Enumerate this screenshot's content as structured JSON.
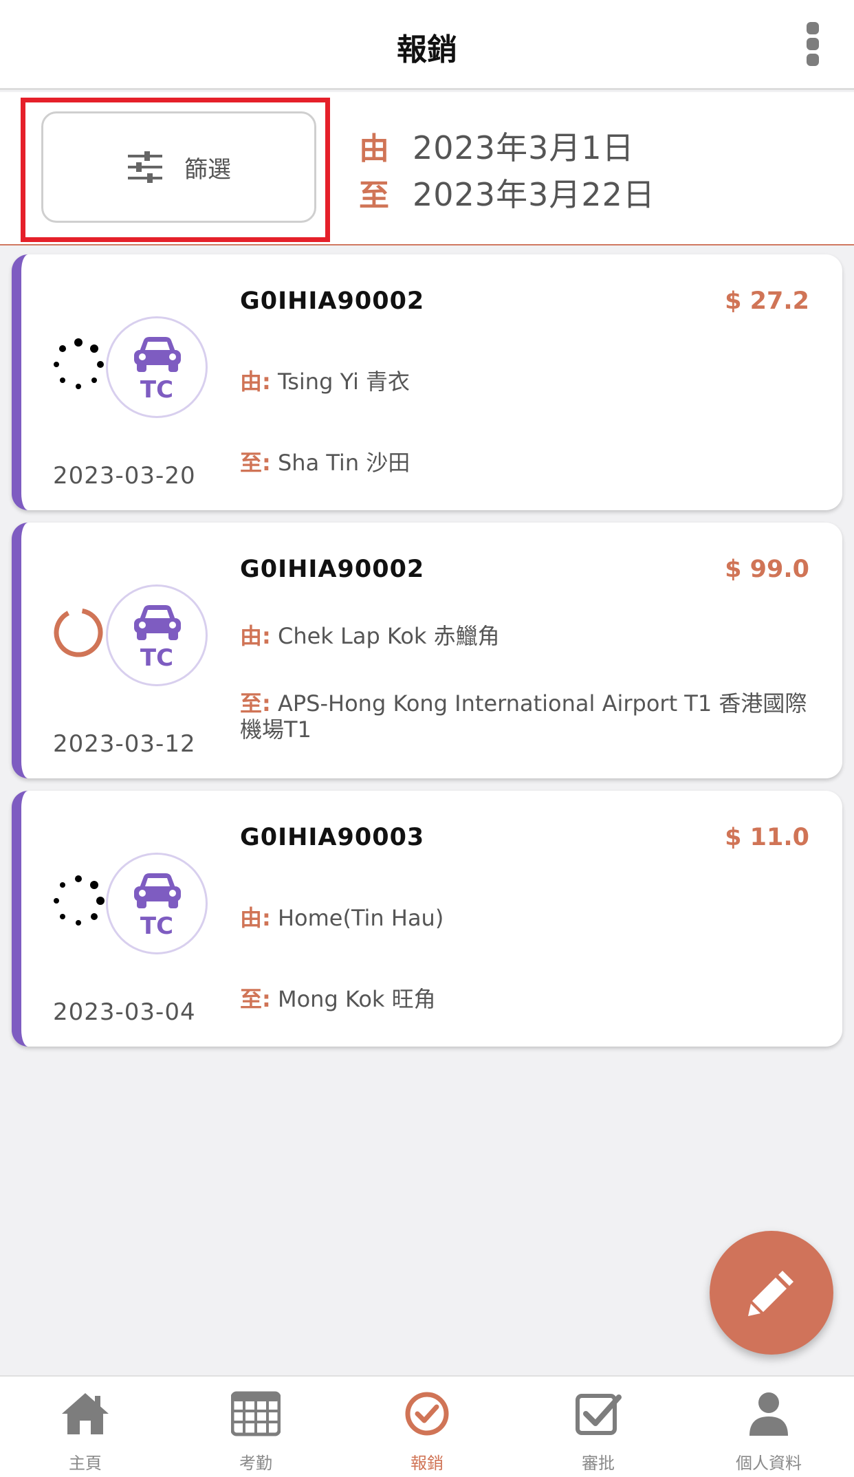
{
  "header": {
    "title": "報銷"
  },
  "filter": {
    "button_label": "篩選",
    "from_prefix": "由",
    "from_date": "2023年3月1日",
    "to_prefix": "至",
    "to_date": "2023年3月22日"
  },
  "claims": [
    {
      "code": "G0IHIA90002",
      "amount": "$ 27.2",
      "vehicle_code": "TC",
      "date": "2023-03-20",
      "from_prefix": "由:",
      "from": "Tsing Yi 青衣",
      "to_prefix": "至:",
      "to": "Sha Tin 沙田",
      "status_icon": "loading-dots-icon"
    },
    {
      "code": "G0IHIA90002",
      "amount": "$ 99.0",
      "vehicle_code": "TC",
      "date": "2023-03-12",
      "from_prefix": "由:",
      "from": "Chek Lap Kok 赤鱲角",
      "to_prefix": "至:",
      "to": "APS-Hong Kong International Airport T1 香港國際機場T1",
      "status_icon": "progress-ring-icon"
    },
    {
      "code": "G0IHIA90003",
      "amount": "$ 11.0",
      "vehicle_code": "TC",
      "date": "2023-03-04",
      "from_prefix": "由:",
      "from": "Home(Tin Hau)",
      "to_prefix": "至:",
      "to": "Mong Kok 旺角",
      "status_icon": "loading-dots-icon"
    }
  ],
  "nav": {
    "items": [
      {
        "label": "主頁",
        "icon": "home-icon"
      },
      {
        "label": "考勤",
        "icon": "calendar-grid-icon"
      },
      {
        "label": "報銷",
        "icon": "check-circle-icon",
        "active": true
      },
      {
        "label": "審批",
        "icon": "approval-check-icon"
      },
      {
        "label": "個人資料",
        "icon": "user-icon"
      }
    ]
  },
  "colors": {
    "accent": "#d07456",
    "card_stripe": "#7e5cc1",
    "highlight": "#e5202a",
    "inactive": "#8a8a8a"
  }
}
